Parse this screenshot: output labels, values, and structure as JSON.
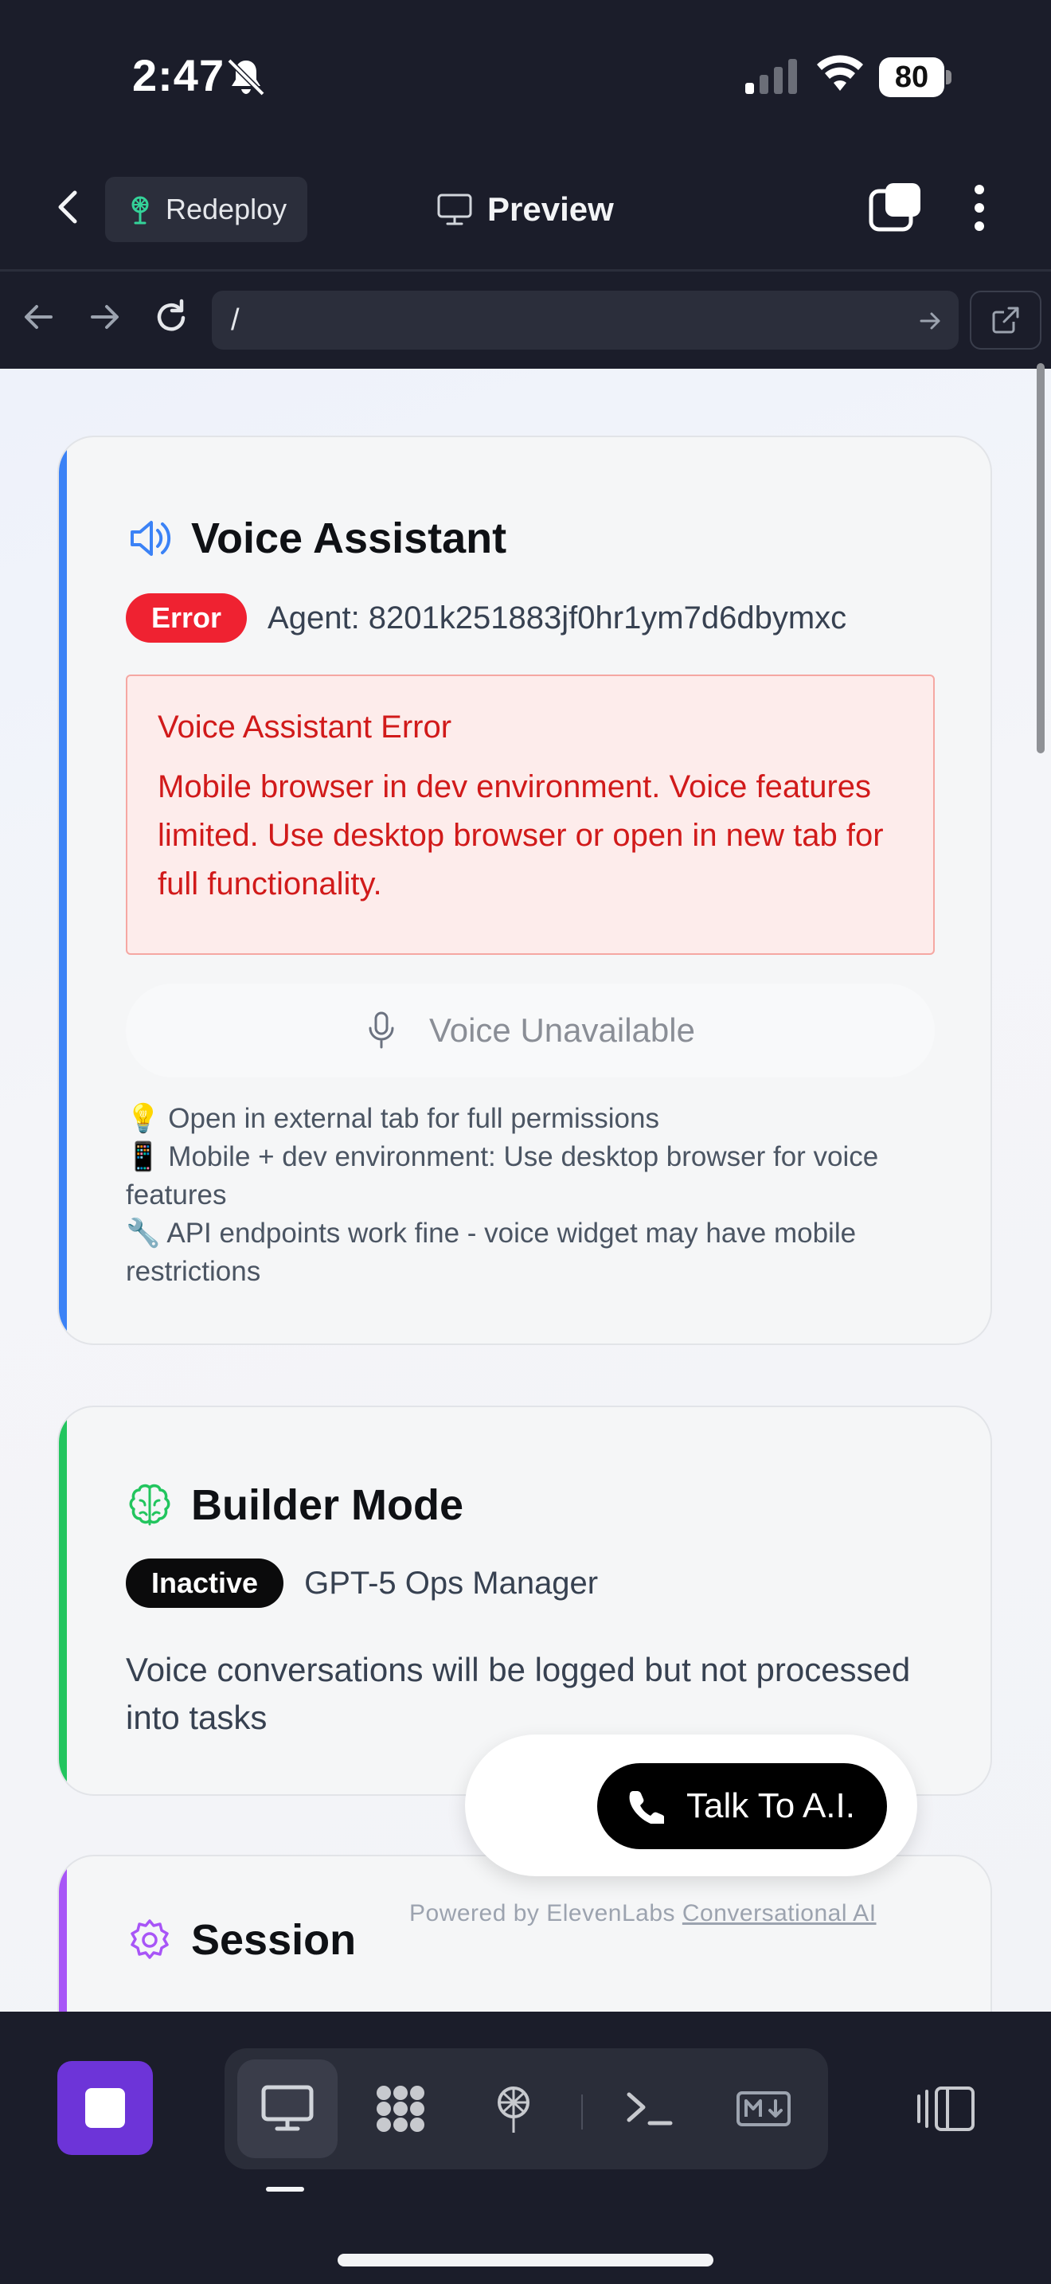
{
  "status_bar": {
    "time": "2:47",
    "battery": "80"
  },
  "header": {
    "redeploy_label": "Redeploy",
    "title": "Preview"
  },
  "browser": {
    "url": "/"
  },
  "voice_card": {
    "title": "Voice Assistant",
    "status_badge": "Error",
    "agent_text": "Agent: 8201k251883jf0hr1ym7d6dbymxc",
    "error_title": "Voice Assistant Error",
    "error_message": "Mobile browser in dev environment. Voice features limited. Use desktop browser or open in new tab for full functionality.",
    "voice_button_label": "Voice Unavailable",
    "tips": [
      "💡 Open in external tab for full permissions",
      "📱 Mobile + dev environment: Use desktop browser for voice features",
      "🔧 API endpoints work fine - voice widget may have mobile restrictions"
    ],
    "accent_color": "#3b82f6",
    "badge_color": "#ef2231"
  },
  "builder_card": {
    "title": "Builder Mode",
    "status_badge": "Inactive",
    "model_text": "GPT-5 Ops Manager",
    "description": "Voice conversations will be logged but not processed into tasks",
    "accent_color": "#22c55e",
    "badge_color": "#0b0b0c"
  },
  "session_card": {
    "title": "Session",
    "accent_color": "#a855f7"
  },
  "talk_widget": {
    "button_label": "Talk To A.I.",
    "powered_by": "Powered by ElevenLabs",
    "powered_link": "Conversational AI"
  },
  "toolbar": {
    "tools": [
      "desktop-icon",
      "apps-icon",
      "deploy-icon",
      "terminal-icon",
      "markdown-icon"
    ],
    "accent_color": "#6d34d8"
  }
}
